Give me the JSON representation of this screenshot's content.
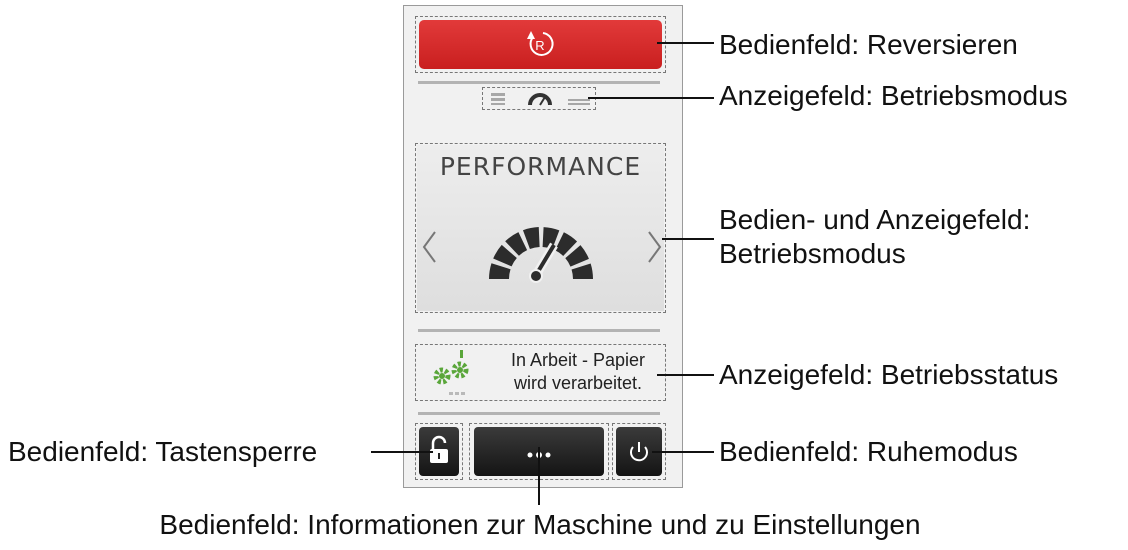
{
  "screen": {
    "mode_title": "PERFORMANCE",
    "status_text_line1": "In Arbeit - Papier",
    "status_text_line2": "wird verarbeitet.",
    "reverse_icon_letter": "R",
    "info_button_icon": "more-dots-icon",
    "lock_button_icon": "unlock-icon",
    "sleep_button_icon": "power-icon",
    "colors": {
      "red": "#d62b2b",
      "green": "#5aa63a",
      "dark": "#1f1f1f",
      "panel": "#f1f1f1"
    }
  },
  "callouts": {
    "reversieren": "Bedienfeld: Reversieren",
    "betriebsmodus_anzeige": "Anzeigefeld: Betriebsmodus",
    "betriebsmodus_bedien_line1": "Bedien- und Anzeigefeld:",
    "betriebsmodus_bedien_line2": "Betriebsmodus",
    "betriebsstatus": "Anzeigefeld: Betriebsstatus",
    "ruhemodus": "Bedienfeld: Ruhemodus",
    "tastensperre": "Bedienfeld: Tastensperre",
    "informationen": "Bedienfeld: Informationen zur Maschine und zu Einstellungen"
  }
}
